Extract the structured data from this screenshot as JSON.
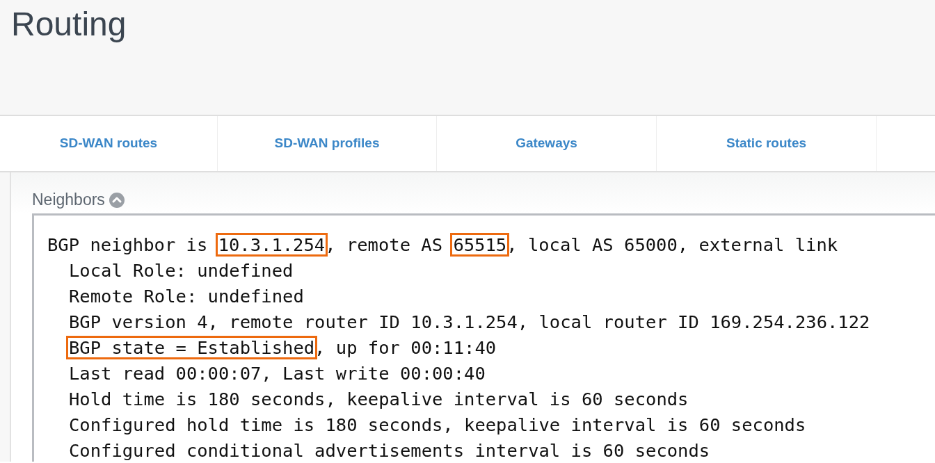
{
  "page": {
    "title": "Routing"
  },
  "tabs": [
    {
      "label": "SD-WAN routes",
      "selected": false
    },
    {
      "label": "SD-WAN profiles",
      "selected": false
    },
    {
      "label": "Gateways",
      "selected": false
    },
    {
      "label": "Static routes",
      "selected": false
    }
  ],
  "section": {
    "title": "Neighbors",
    "expanded": true
  },
  "output": {
    "lines": [
      {
        "segments": [
          {
            "text": "BGP neighbor is ",
            "highlighted": false
          },
          {
            "text": "10.3.1.254",
            "highlighted": true
          },
          {
            "text": ", remote AS ",
            "highlighted": false
          },
          {
            "text": "65515",
            "highlighted": true
          },
          {
            "text": ", local AS 65000, external link",
            "highlighted": false
          }
        ],
        "children": [
          {
            "segments": [
              {
                "text": "Local Role: undefined",
                "highlighted": false
              }
            ]
          },
          {
            "segments": [
              {
                "text": "Remote Role: undefined",
                "highlighted": false
              }
            ]
          },
          {
            "segments": [
              {
                "text": "BGP version 4, remote router ID 10.3.1.254, local router ID 169.254.236.122",
                "highlighted": false
              }
            ]
          },
          {
            "segments": [
              {
                "text": "BGP state = Established",
                "highlighted": true
              },
              {
                "text": ", up for 00:11:40",
                "highlighted": false
              }
            ]
          },
          {
            "segments": [
              {
                "text": "Last read 00:00:07, Last write 00:00:40",
                "highlighted": false
              }
            ]
          },
          {
            "segments": [
              {
                "text": "Hold time is 180 seconds, keepalive interval is 60 seconds",
                "highlighted": false
              }
            ]
          },
          {
            "segments": [
              {
                "text": "Configured hold time is 180 seconds, keepalive interval is 60 seconds",
                "highlighted": false
              }
            ]
          },
          {
            "segments": [
              {
                "text": "Configured conditional advertisements interval is 60 seconds",
                "highlighted": false
              }
            ]
          }
        ]
      }
    ]
  }
}
